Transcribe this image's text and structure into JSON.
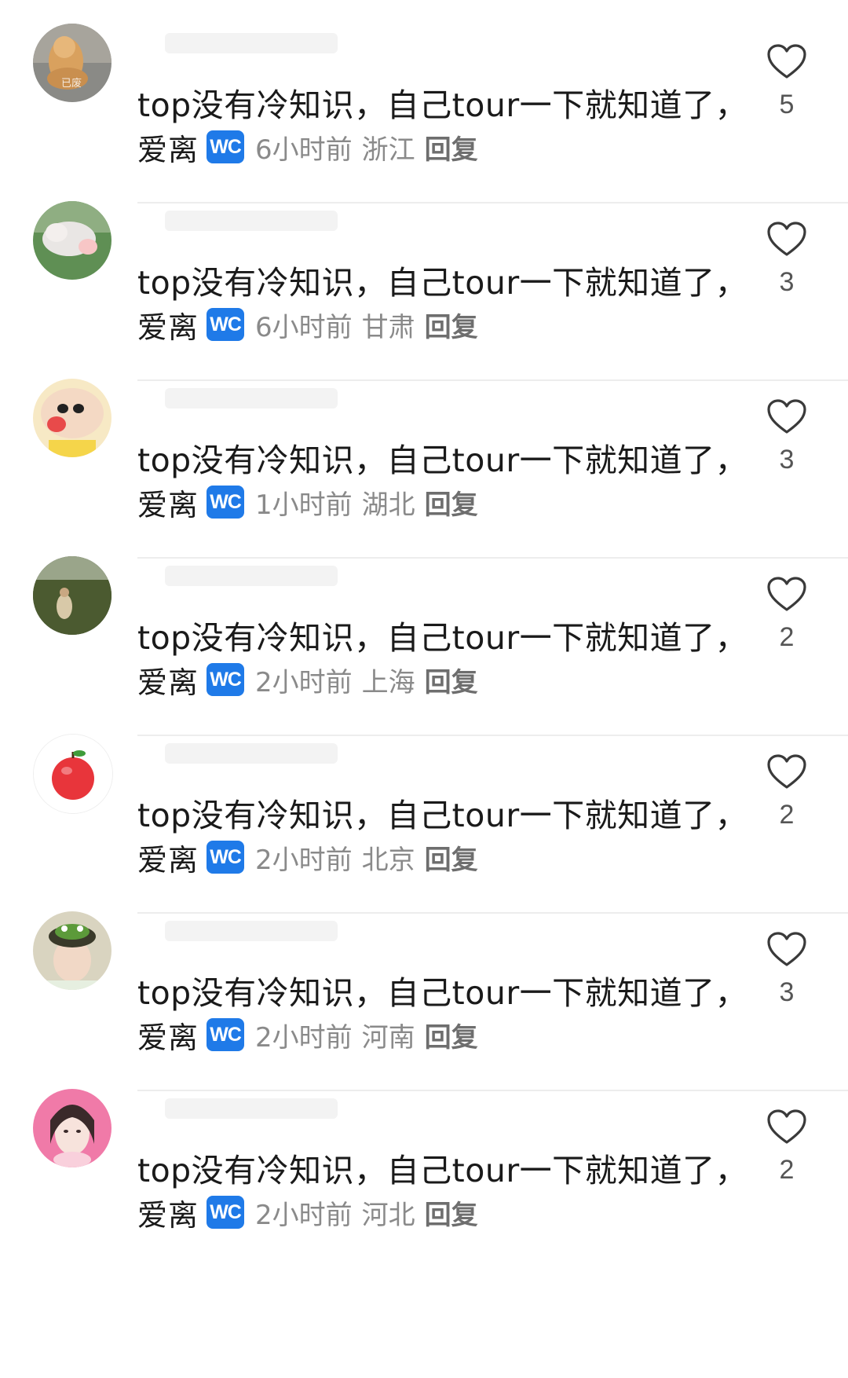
{
  "comments": [
    {
      "text": "top没有冷知识，自己tour一下就知道了，",
      "author_reply": "爱离",
      "badge": "WC",
      "time": "6小时前",
      "location": "浙江",
      "reply": "回复",
      "likes": "5",
      "avatar_watermark": "已废"
    },
    {
      "text": "top没有冷知识，自己tour一下就知道了，",
      "author_reply": "爱离",
      "badge": "WC",
      "time": "6小时前",
      "location": "甘肃",
      "reply": "回复",
      "likes": "3"
    },
    {
      "text": "top没有冷知识，自己tour一下就知道了，",
      "author_reply": "爱离",
      "badge": "WC",
      "time": "1小时前",
      "location": "湖北",
      "reply": "回复",
      "likes": "3"
    },
    {
      "text": "top没有冷知识，自己tour一下就知道了，",
      "author_reply": "爱离",
      "badge": "WC",
      "time": "2小时前",
      "location": "上海",
      "reply": "回复",
      "likes": "2"
    },
    {
      "text": "top没有冷知识，自己tour一下就知道了，",
      "author_reply": "爱离",
      "badge": "WC",
      "time": "2小时前",
      "location": "北京",
      "reply": "回复",
      "likes": "2"
    },
    {
      "text": "top没有冷知识，自己tour一下就知道了，",
      "author_reply": "爱离",
      "badge": "WC",
      "time": "2小时前",
      "location": "河南",
      "reply": "回复",
      "likes": "3"
    },
    {
      "text": "top没有冷知识，自己tour一下就知道了，",
      "author_reply": "爱离",
      "badge": "WC",
      "time": "2小时前",
      "location": "河北",
      "reply": "回复",
      "likes": "2"
    }
  ],
  "icons": {
    "like": "heart-outline-icon",
    "badge": "wc-badge"
  },
  "colors": {
    "badge_bg": "#1f7ae8",
    "text": "#1a1a1a",
    "meta": "#8a8a8a",
    "like_icon": "#3a3a3a"
  }
}
